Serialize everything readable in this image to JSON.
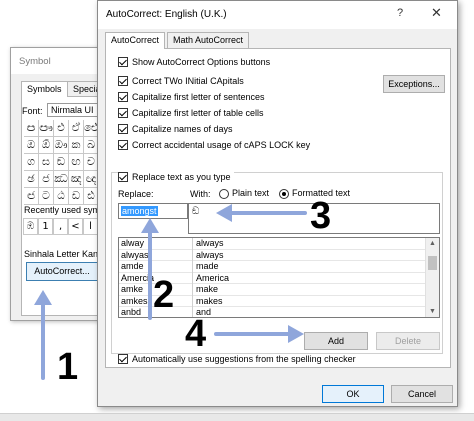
{
  "symbol_dialog": {
    "title": "Symbol",
    "tabs": [
      "Symbols",
      "Special"
    ],
    "font_label": "Font:",
    "font_value": "Nirmala UI",
    "grid": [
      [
        "ඏ",
        "ඐ",
        "එ",
        "ඒ",
        "ඓ"
      ],
      [
        "ඔ",
        "ඕ",
        "ඖ",
        "ක",
        "ඛ"
      ],
      [
        "ග",
        "ඝ",
        "ඞ",
        "ඟ",
        "ච"
      ],
      [
        "ඡ",
        "ජ",
        "ඣ",
        "ඤ",
        "ඥ"
      ],
      [
        "ඦ",
        "ට",
        "ඨ",
        "ඩ",
        "ඪ"
      ],
      [
        "ණ",
        "ඬ",
        "ත",
        "ථ",
        "ද"
      ],
      [
        "ධ",
        "න",
        "ඳ",
        "ප",
        "ඵ"
      ]
    ],
    "recent_label": "Recently used sym",
    "recent": [
      "ඹ",
      "1",
      "‚",
      "<",
      "l"
    ],
    "char_name": "Sinhala Letter Kant",
    "autocorrect_button": "AutoCorrect..."
  },
  "autocorrect_dialog": {
    "title": "AutoCorrect: English (U.K.)",
    "help": "?",
    "close": "✕",
    "tabs": [
      "AutoCorrect",
      "Math AutoCorrect"
    ],
    "options": [
      {
        "label": "Show AutoCorrect Options buttons",
        "checked": true
      },
      {
        "label": "Correct TWo INitial CApitals",
        "checked": true
      },
      {
        "label": "Capitalize first letter of sentences",
        "checked": true
      },
      {
        "label": "Capitalize first letter of table cells",
        "checked": true
      },
      {
        "label": "Capitalize names of days",
        "checked": true
      },
      {
        "label": "Correct accidental usage of cAPS LOCK key",
        "checked": true
      }
    ],
    "exceptions_button": "Exceptions...",
    "replace_as_you_type": {
      "label": "Replace text as you type",
      "checked": true
    },
    "replace_label": "Replace:",
    "with_label": "With:",
    "plain_text": "Plain text",
    "formatted_text": "Formatted text",
    "replace_value": "amongst",
    "with_value": "ඞ",
    "list": [
      {
        "from": "alway",
        "to": "always"
      },
      {
        "from": "alwyas",
        "to": "always"
      },
      {
        "from": "amde",
        "to": "made"
      },
      {
        "from": "Amercia",
        "to": "America"
      },
      {
        "from": "amke",
        "to": "make"
      },
      {
        "from": "amkes",
        "to": "makes"
      },
      {
        "from": "anbd",
        "to": "and"
      }
    ],
    "add_button": "Add",
    "delete_button": "Delete",
    "auto_suggest": {
      "label": "Automatically use suggestions from the spelling checker",
      "checked": true
    },
    "ok_button": "OK",
    "cancel_button": "Cancel"
  },
  "annotations": [
    "1",
    "2",
    "3",
    "4"
  ],
  "colors": {
    "arrow": "#8fa6db",
    "selection": "#3399ff",
    "default_button": "#0078d7"
  }
}
